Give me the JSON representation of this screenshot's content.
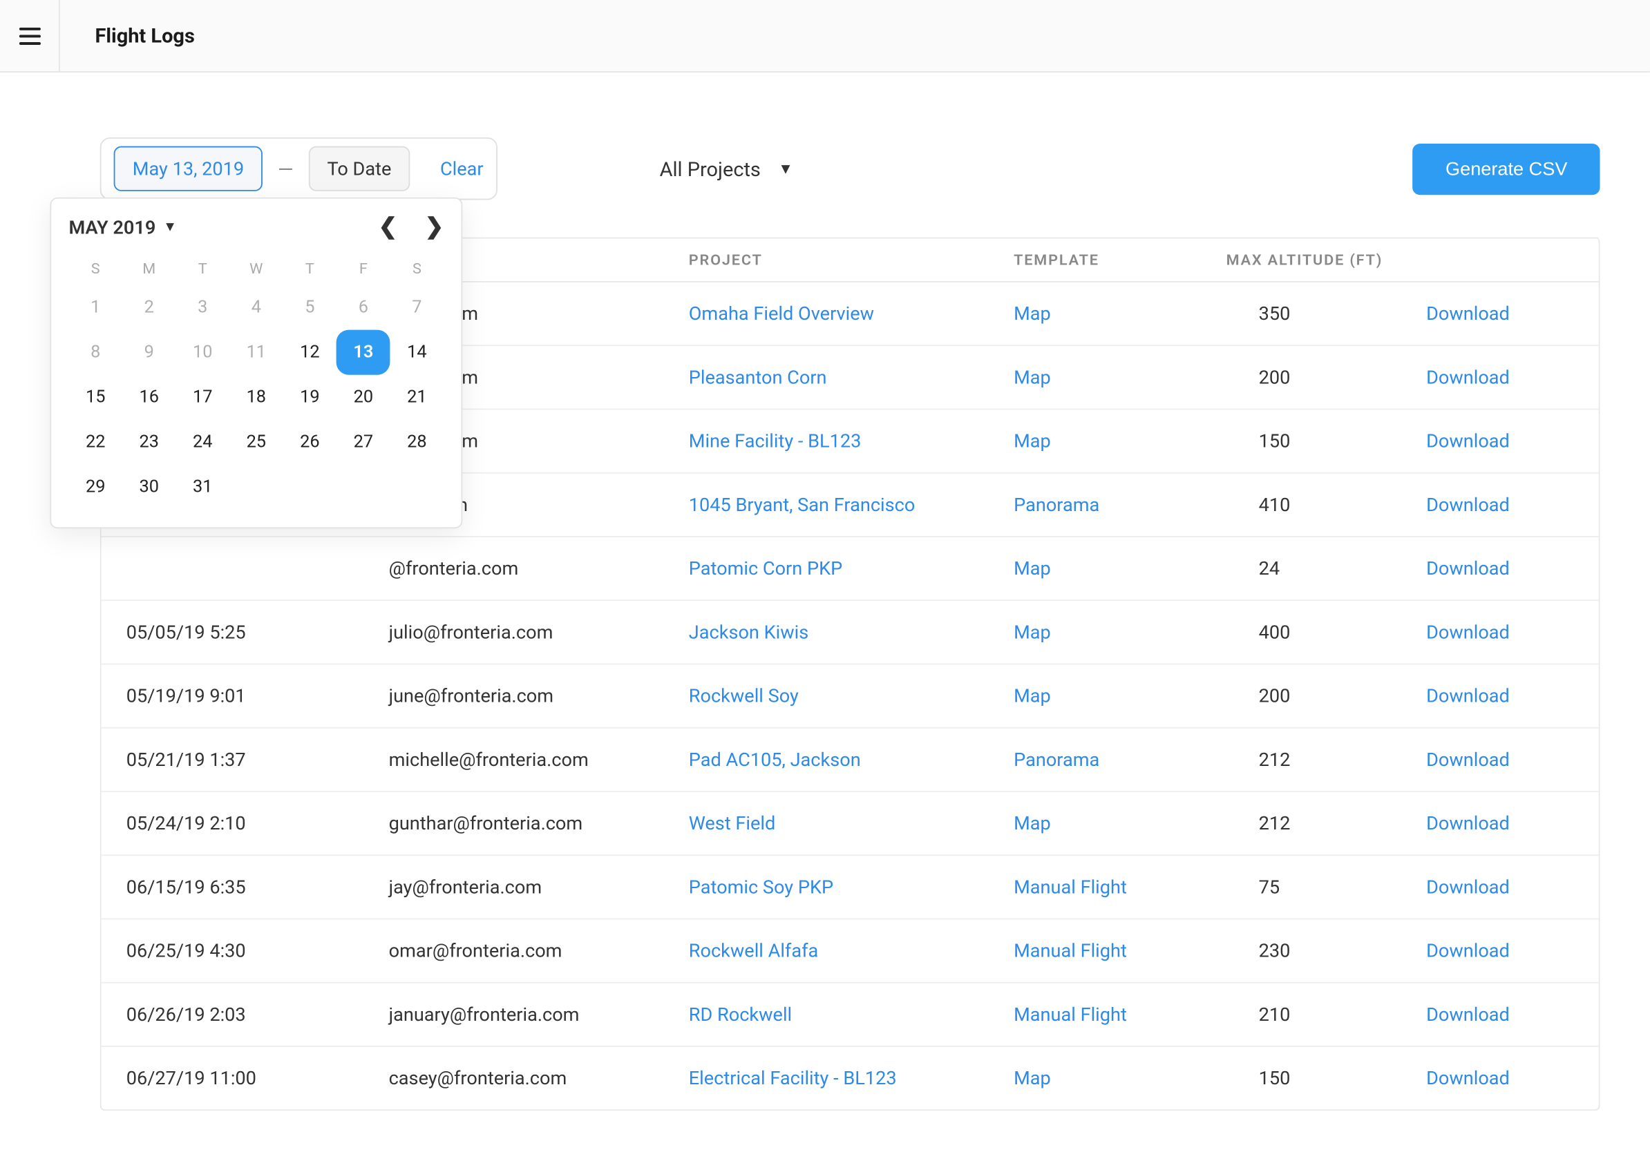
{
  "header": {
    "title": "Flight Logs"
  },
  "filters": {
    "from_date_label": "May 13, 2019",
    "dash": "—",
    "to_date_label": "To Date",
    "clear_label": "Clear",
    "project_select_label": "All Projects",
    "csv_button_label": "Generate CSV"
  },
  "calendar": {
    "month_label": "MAY 2019",
    "dows": [
      "S",
      "M",
      "T",
      "W",
      "T",
      "F",
      "S"
    ],
    "days": [
      {
        "n": 1,
        "cur": false
      },
      {
        "n": 2,
        "cur": false
      },
      {
        "n": 3,
        "cur": false
      },
      {
        "n": 4,
        "cur": false
      },
      {
        "n": 5,
        "cur": false
      },
      {
        "n": 6,
        "cur": false
      },
      {
        "n": 7,
        "cur": false
      },
      {
        "n": 8,
        "cur": false
      },
      {
        "n": 9,
        "cur": false
      },
      {
        "n": 10,
        "cur": false
      },
      {
        "n": 11,
        "cur": false
      },
      {
        "n": 12,
        "cur": true
      },
      {
        "n": 13,
        "cur": true,
        "sel": true
      },
      {
        "n": 14,
        "cur": true
      },
      {
        "n": 15,
        "cur": true
      },
      {
        "n": 16,
        "cur": true
      },
      {
        "n": 17,
        "cur": true
      },
      {
        "n": 18,
        "cur": true
      },
      {
        "n": 19,
        "cur": true
      },
      {
        "n": 20,
        "cur": true
      },
      {
        "n": 21,
        "cur": true
      },
      {
        "n": 22,
        "cur": true
      },
      {
        "n": 23,
        "cur": true
      },
      {
        "n": 24,
        "cur": true
      },
      {
        "n": 25,
        "cur": true
      },
      {
        "n": 26,
        "cur": true
      },
      {
        "n": 27,
        "cur": true
      },
      {
        "n": 28,
        "cur": true
      },
      {
        "n": 29,
        "cur": true
      },
      {
        "n": 30,
        "cur": true
      },
      {
        "n": 31,
        "cur": true
      }
    ]
  },
  "table": {
    "headers": {
      "project": "PROJECT",
      "template": "TEMPLATE",
      "altitude": "MAX ALTITUDE (FT)"
    },
    "download_label": "Download",
    "rows": [
      {
        "date": "",
        "pilot": "nteria.com",
        "project": "Omaha Field Overview",
        "template": "Map",
        "alt": "350"
      },
      {
        "date": "",
        "pilot": "nteria.com",
        "project": "Pleasanton Corn",
        "template": "Map",
        "alt": "200"
      },
      {
        "date": "",
        "pilot": "nteria.com",
        "project": "Mine Facility - BL123",
        "template": "Map",
        "alt": "150"
      },
      {
        "date": "",
        "pilot": "teria.com",
        "project": "1045 Bryant, San Francisco",
        "template": "Panorama",
        "alt": "410"
      },
      {
        "date": "",
        "pilot": "@fronteria.com",
        "project": "Patomic Corn PKP",
        "template": "Map",
        "alt": "24"
      },
      {
        "date": "05/05/19 5:25",
        "pilot": "julio@fronteria.com",
        "project": "Jackson Kiwis",
        "template": "Map",
        "alt": "400"
      },
      {
        "date": "05/19/19 9:01",
        "pilot": "june@fronteria.com",
        "project": "Rockwell Soy",
        "template": "Map",
        "alt": "200"
      },
      {
        "date": "05/21/19 1:37",
        "pilot": "michelle@fronteria.com",
        "project": "Pad AC105, Jackson",
        "template": "Panorama",
        "alt": "212"
      },
      {
        "date": "05/24/19 2:10",
        "pilot": "gunthar@fronteria.com",
        "project": "West Field",
        "template": "Map",
        "alt": "212"
      },
      {
        "date": "06/15/19 6:35",
        "pilot": "jay@fronteria.com",
        "project": "Patomic Soy PKP",
        "template": "Manual Flight",
        "alt": "75"
      },
      {
        "date": "06/25/19 4:30",
        "pilot": "omar@fronteria.com",
        "project": "Rockwell Alfafa",
        "template": "Manual Flight",
        "alt": "230"
      },
      {
        "date": "06/26/19 2:03",
        "pilot": "january@fronteria.com",
        "project": "RD Rockwell",
        "template": "Manual Flight",
        "alt": "210"
      },
      {
        "date": "06/27/19 11:00",
        "pilot": "casey@fronteria.com",
        "project": "Electrical Facility - BL123",
        "template": "Map",
        "alt": "150"
      }
    ]
  }
}
